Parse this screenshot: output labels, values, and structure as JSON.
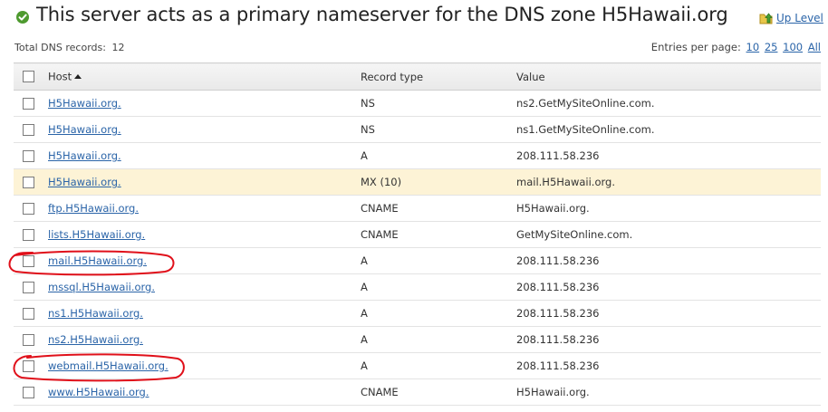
{
  "header": {
    "title": "This server acts as a primary nameserver for the DNS zone H5Hawaii.org",
    "status_icon": "check-circle-icon",
    "up_level_label": "Up Level",
    "up_level_icon": "folder-up-arrow-icon"
  },
  "summary": {
    "total_label": "Total DNS records:",
    "total_count": "12",
    "entries_label": "Entries per page:",
    "entries_options": [
      "10",
      "25",
      "100",
      "All"
    ]
  },
  "table": {
    "columns": [
      "Host",
      "Record type",
      "Value"
    ],
    "sorted_column": "Host",
    "sort_direction": "ascending",
    "rows": [
      {
        "host": "H5Hawaii.org.",
        "type": "NS",
        "value": "ns2.GetMySiteOnline.com."
      },
      {
        "host": "H5Hawaii.org.",
        "type": "NS",
        "value": "ns1.GetMySiteOnline.com."
      },
      {
        "host": "H5Hawaii.org.",
        "type": "A",
        "value": "208.111.58.236"
      },
      {
        "host": "H5Hawaii.org.",
        "type": "MX (10)",
        "value": "mail.H5Hawaii.org."
      },
      {
        "host": "ftp.H5Hawaii.org.",
        "type": "CNAME",
        "value": "H5Hawaii.org."
      },
      {
        "host": "lists.H5Hawaii.org.",
        "type": "CNAME",
        "value": "GetMySiteOnline.com."
      },
      {
        "host": "mail.H5Hawaii.org.",
        "type": "A",
        "value": "208.111.58.236"
      },
      {
        "host": "mssql.H5Hawaii.org.",
        "type": "A",
        "value": "208.111.58.236"
      },
      {
        "host": "ns1.H5Hawaii.org.",
        "type": "A",
        "value": "208.111.58.236"
      },
      {
        "host": "ns2.H5Hawaii.org.",
        "type": "A",
        "value": "208.111.58.236"
      },
      {
        "host": "webmail.H5Hawaii.org.",
        "type": "A",
        "value": "208.111.58.236"
      },
      {
        "host": "www.H5Hawaii.org.",
        "type": "CNAME",
        "value": "H5Hawaii.org."
      }
    ]
  },
  "colors": {
    "link": "#2a64a8",
    "highlight_row": "#fdf3d6",
    "annotation": "#e0101a",
    "status_green": "#4e9a2f"
  }
}
